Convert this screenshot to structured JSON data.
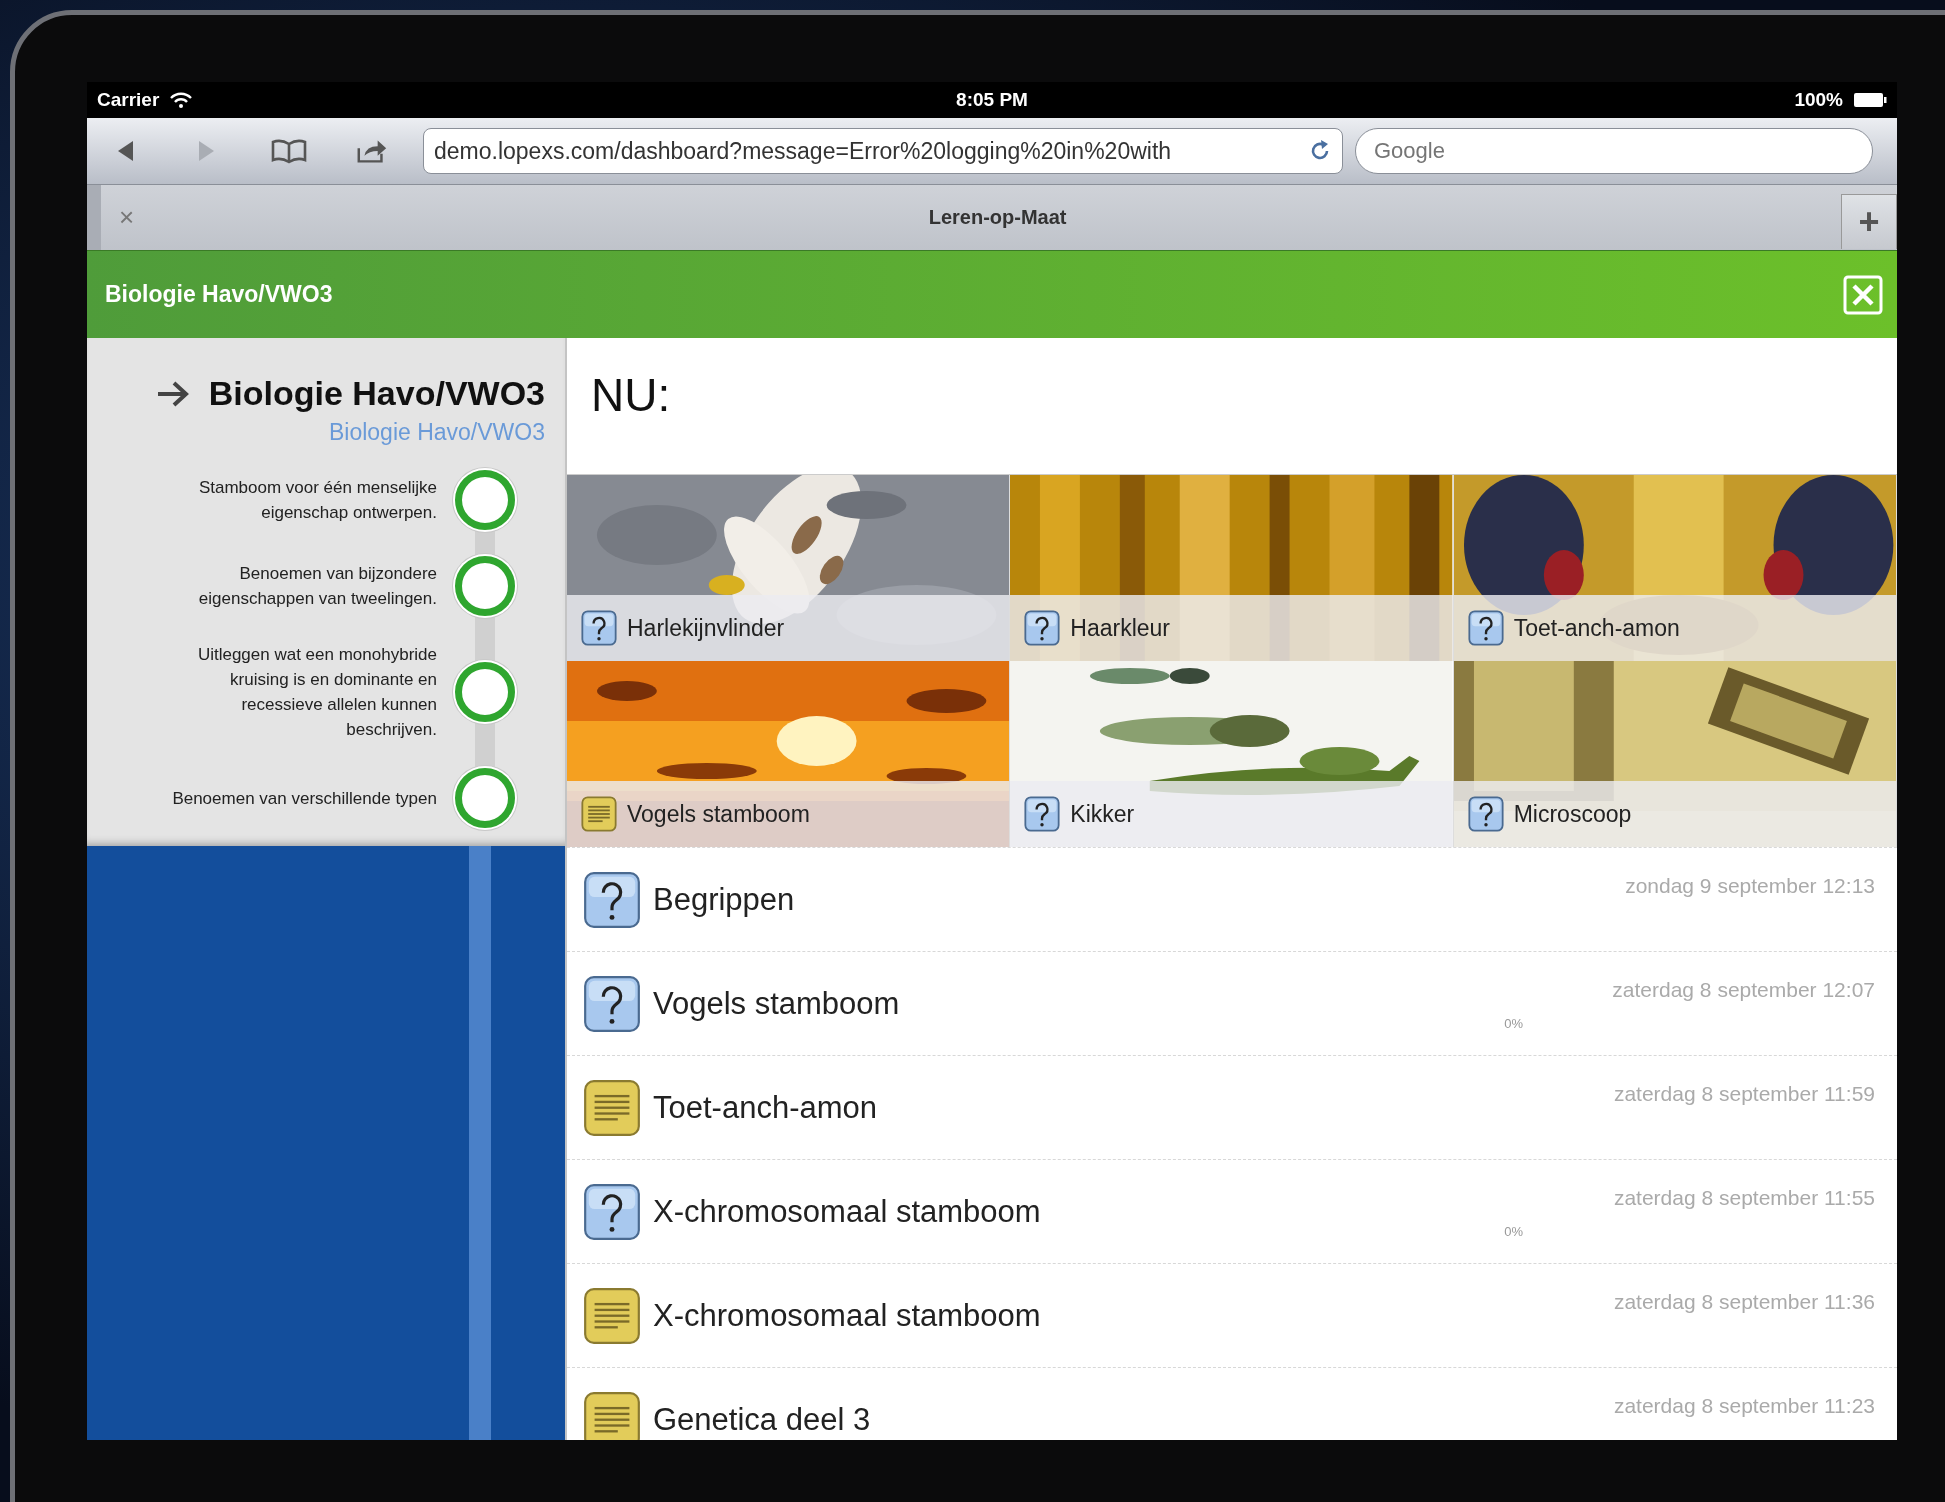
{
  "status_bar": {
    "carrier": "Carrier",
    "time": "8:05 PM",
    "battery": "100%"
  },
  "browser": {
    "url": "demo.lopexs.com/dashboard?message=Error%20logging%20in%20with",
    "search_placeholder": "Google",
    "tab_close": "×",
    "tab_title": "Leren-op-Maat",
    "new_tab": "+"
  },
  "header": {
    "title": "Biologie Havo/VWO3"
  },
  "sidebar": {
    "title": "Biologie Havo/VWO3",
    "link": "Biologie Havo/VWO3",
    "goals": [
      {
        "text": "Stamboom voor één menselijke eigenschap ontwerpen."
      },
      {
        "text": "Benoemen van bijzondere eigenschappen van tweelingen."
      },
      {
        "text": "Uitleggen wat een monohybride kruising is en dominante en recessieve allelen kunnen beschrijven."
      },
      {
        "text": "Benoemen van verschillende typen"
      }
    ]
  },
  "main": {
    "heading": "NU:",
    "tiles": [
      {
        "label": "Harlekijnvlinder",
        "kind": "quiz"
      },
      {
        "label": "Haarkleur",
        "kind": "quiz"
      },
      {
        "label": "Toet-anch-amon",
        "kind": "quiz"
      },
      {
        "label": "Vogels stamboom",
        "kind": "text"
      },
      {
        "label": "Kikker",
        "kind": "quiz"
      },
      {
        "label": "Microscoop",
        "kind": "quiz"
      }
    ],
    "activities": [
      {
        "title": "Begrippen",
        "date": "zondag 9 september 12:13",
        "kind": "quiz"
      },
      {
        "title": "Vogels stamboom",
        "date": "zaterdag 8 september 12:07",
        "kind": "quiz",
        "progress": "0%"
      },
      {
        "title": "Toet-anch-amon",
        "date": "zaterdag 8 september 11:59",
        "kind": "text"
      },
      {
        "title": "X-chromosomaal stamboom",
        "date": "zaterdag 8 september 11:55",
        "kind": "quiz",
        "progress": "0%"
      },
      {
        "title": "X-chromosomaal stamboom",
        "date": "zaterdag 8 september 11:36",
        "kind": "text"
      },
      {
        "title": "Genetica deel 3",
        "date": "zaterdag 8 september 11:23",
        "kind": "text"
      }
    ]
  }
}
